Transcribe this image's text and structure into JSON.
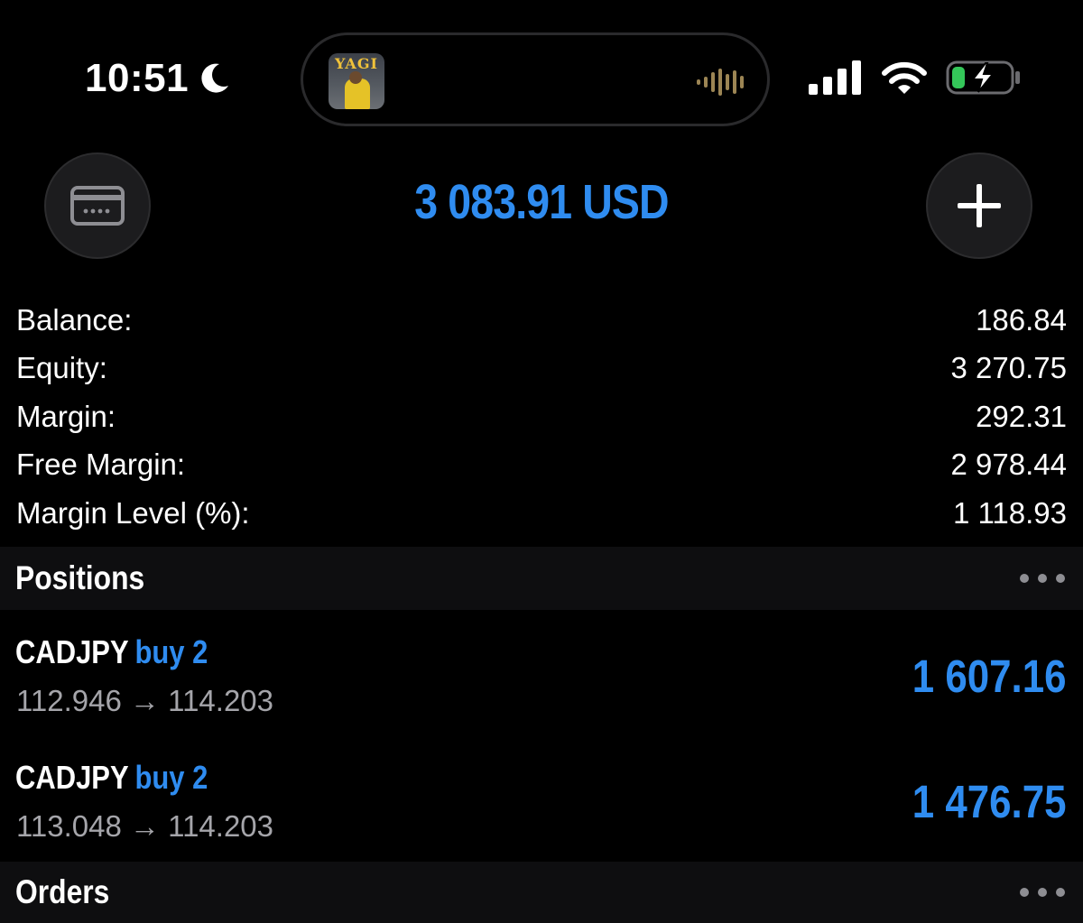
{
  "status_bar": {
    "time": "10:51",
    "moon_icon": "moon-icon",
    "now_playing": {
      "album_title": "YAGI",
      "waveform_icon": "waveform-icon"
    },
    "icons": [
      "cellular-signal-icon",
      "wifi-icon",
      "battery-charging-icon"
    ],
    "battery_color": "#34c759"
  },
  "header": {
    "left_icon": "card-icon",
    "balance_display": "3 083.91 USD",
    "right_icon": "plus-icon",
    "accent_color": "#2f8cf0"
  },
  "summary": [
    {
      "label": "Balance:",
      "value": "186.84"
    },
    {
      "label": "Equity:",
      "value": "3 270.75"
    },
    {
      "label": "Margin:",
      "value": "292.31"
    },
    {
      "label": "Free Margin:",
      "value": "2 978.44"
    },
    {
      "label": "Margin Level (%):",
      "value": "1 118.93"
    }
  ],
  "positions_section": {
    "title": "Positions",
    "more_icon": "more-dots-icon",
    "items": [
      {
        "symbol": "CADJPY",
        "type": "buy 2",
        "prices": "112.946 → 114.203",
        "profit": "1 607.16"
      },
      {
        "symbol": "CADJPY",
        "type": "buy 2",
        "prices": "113.048 → 114.203",
        "profit": "1 476.75"
      }
    ]
  },
  "orders_section": {
    "title": "Orders",
    "more_icon": "more-dots-icon"
  }
}
